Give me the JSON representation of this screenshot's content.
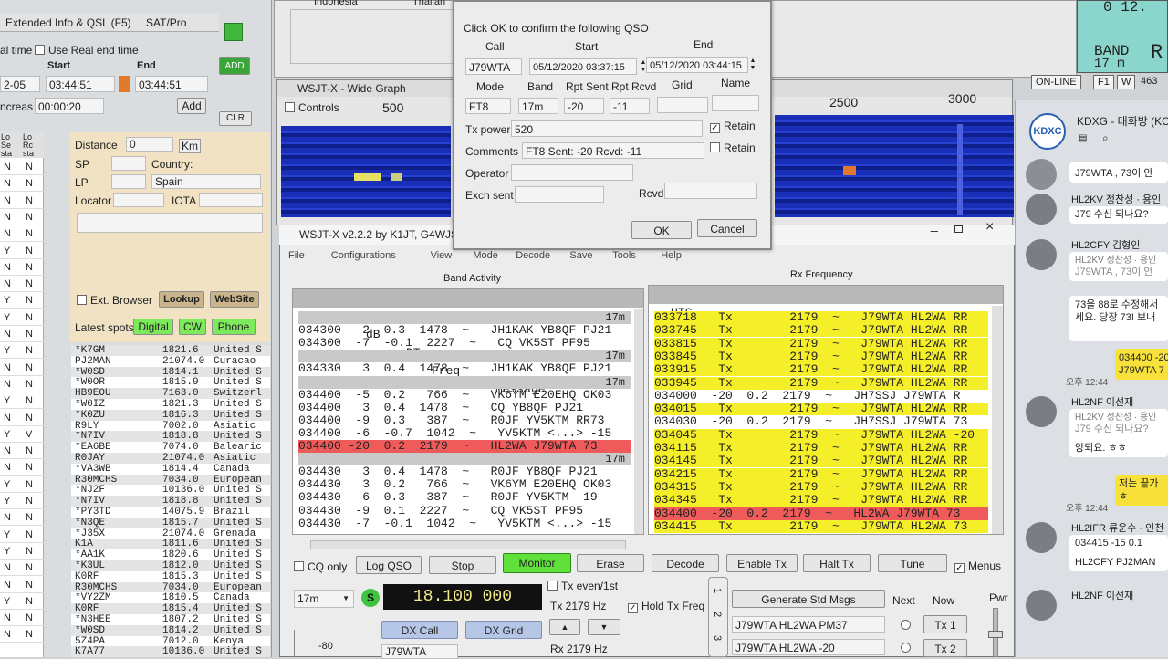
{
  "log_panel": {
    "tabs": [
      "Extended Info & QSL (F5)",
      "SAT/Pro"
    ],
    "real_time_label": "al time",
    "use_real_end_label": "Use Real end time",
    "start_label": "Start",
    "end_label": "End",
    "date_value": "2-05",
    "start_time": "03:44:51",
    "end_time": "03:44:51",
    "increase_label": "ncreas",
    "increase_value": "00:00:20",
    "add_green": "ADD",
    "add": "Add",
    "clr": "CLR",
    "col_headers": [
      "Lo Se sta",
      "Lo Rc sta"
    ],
    "yn_rows": [
      [
        "N",
        "N"
      ],
      [
        "N",
        "N"
      ],
      [
        "N",
        "N"
      ],
      [
        "N",
        "N"
      ],
      [
        "N",
        "N"
      ],
      [
        "Y",
        "N"
      ],
      [
        "N",
        "N"
      ],
      [
        "N",
        "N"
      ],
      [
        "Y",
        "N"
      ],
      [
        "Y",
        "N"
      ],
      [
        "N",
        "N"
      ],
      [
        "Y",
        "N"
      ],
      [
        "N",
        "N"
      ],
      [
        "N",
        "N"
      ],
      [
        "Y",
        "N"
      ],
      [
        "N",
        "N"
      ],
      [
        "Y",
        "V"
      ],
      [
        "N",
        "N"
      ],
      [
        "N",
        "N"
      ],
      [
        "Y",
        "N"
      ],
      [
        "Y",
        "N"
      ],
      [
        "N",
        "N"
      ],
      [
        "Y",
        "N"
      ],
      [
        "Y",
        "N"
      ],
      [
        "N",
        "N"
      ],
      [
        "N",
        "N"
      ],
      [
        "Y",
        "N"
      ],
      [
        "N",
        "N"
      ],
      [
        "N",
        "N"
      ]
    ]
  },
  "info_panel": {
    "distance_label": "Distance",
    "distance_value": "0",
    "km": "Km",
    "sp": "SP",
    "lp": "LP",
    "country_label": "Country:",
    "country_value": "Spain",
    "locator": "Locator",
    "iota": "IOTA",
    "ext_browser": "Ext. Browser",
    "lookup": "Lookup",
    "website": "WebSite",
    "latest_spots": "Latest spots",
    "spot_buttons": [
      "Digital",
      "CW",
      "Phone"
    ]
  },
  "spots": [
    [
      "*K7GM",
      "1821.6",
      "United S"
    ],
    [
      "PJ2MAN",
      "21074.0",
      "Curacao"
    ],
    [
      "*W0SD",
      "1814.1",
      "United S"
    ],
    [
      "*W0OR",
      "1815.9",
      "United S"
    ],
    [
      "HB9EOU",
      "7163.0",
      "Switzerl"
    ],
    [
      "*W0IZ",
      "1821.3",
      "United S"
    ],
    [
      "*K0ZU",
      "1816.3",
      "United S"
    ],
    [
      "R9LY",
      "7002.0",
      "Asiatic"
    ],
    [
      "*N7IV",
      "1818.8",
      "United S"
    ],
    [
      "*EA6BE",
      "7074.0",
      "Balearic"
    ],
    [
      "R0JAY",
      "21074.0",
      "Asiatic"
    ],
    [
      "*VA3WB",
      "1814.4",
      "Canada"
    ],
    [
      "R30MCHS",
      "7034.0",
      "European"
    ],
    [
      "*NJ2F",
      "10136.0",
      "United S"
    ],
    [
      "*N7IV",
      "1818.8",
      "United S"
    ],
    [
      "*PY3TD",
      "14075.9",
      "Brazil"
    ],
    [
      "*N3QE",
      "1815.7",
      "United S"
    ],
    [
      "*J35X",
      "21074.0",
      "Grenada"
    ],
    [
      "K1A",
      "1811.6",
      "United S"
    ],
    [
      "*AA1K",
      "1820.6",
      "United S"
    ],
    [
      "*K3UL",
      "1812.0",
      "United S"
    ],
    [
      "K0RF",
      "1815.3",
      "United S"
    ],
    [
      "R30MCHS",
      "7034.0",
      "European"
    ],
    [
      "*VY2ZM",
      "1810.5",
      "Canada"
    ],
    [
      "K0RF",
      "1815.4",
      "United S"
    ],
    [
      "*N3HEE",
      "1807.2",
      "United S"
    ],
    [
      "*W0SD",
      "1814.2",
      "United S"
    ],
    [
      "5Z4PA",
      "7012.0",
      "Kenya"
    ],
    [
      "K7A77",
      "10136.0",
      "United S"
    ]
  ],
  "top_window": {
    "country1": "Indonesia",
    "country2": "Thailan"
  },
  "top_right": {
    "band_label": "BAND",
    "band_value": "17 m",
    "clock": "0 12.",
    "status": [
      "ON-LINE",
      "F1",
      "W",
      "463"
    ]
  },
  "wide_graph": {
    "title": "WSJT-X - Wide Graph",
    "controls": "Controls",
    "ticks_left": [
      "500"
    ],
    "ticks_right": [
      "2500",
      "3000"
    ]
  },
  "confirm_dialog": {
    "prompt": "Click OK to confirm the following QSO",
    "call_label": "Call",
    "start_label": "Start",
    "end_label": "End",
    "call": "J79WTA",
    "start": "05/12/2020 03:37:15",
    "end": "05/12/2020 03:44:15",
    "mode_label": "Mode",
    "band_label": "Band",
    "rpt_sent_label": "Rpt Sent",
    "rpt_rcvd_label": "Rpt Rcvd",
    "grid_label": "Grid",
    "name_label": "Name",
    "mode": "FT8",
    "band": "17m",
    "rpt_sent": "-20",
    "rpt_rcvd": "-11",
    "tx_power_label": "Tx power",
    "tx_power": "520",
    "retain": "Retain",
    "comments_label": "Comments",
    "comments": "FT8  Sent: -20  Rcvd: -11",
    "operator_label": "Operator",
    "exch_sent_label": "Exch sent",
    "rcvd_label": "Rcvd",
    "ok": "OK",
    "cancel": "Cancel"
  },
  "wsjtx": {
    "title": "WSJT-X   v2.2.2   by K1JT, G4WJS",
    "menu": [
      "File",
      "Configurations",
      "View",
      "Mode",
      "Decode",
      "Save",
      "Tools",
      "Help"
    ],
    "band_activity": "Band Activity",
    "rx_frequency": "Rx Frequency",
    "headers": [
      "UTC",
      "dB",
      "DT",
      "Freq",
      "Message"
    ],
    "band_rows": [
      {
        "t": "",
        "sep": "17m"
      },
      {
        "t": "034300   2  0.3  1478  ~   JH1KAK YB8QF PJ21"
      },
      {
        "t": "034300  -7  -0.1  2227  ~   CQ VK5ST PF95"
      },
      {
        "t": "",
        "sep": "17m"
      },
      {
        "t": "034330   3  0.4  1478  ~   JH1KAK YB8QF PJ21"
      },
      {
        "t": "",
        "sep": "17m"
      },
      {
        "t": "034400  -5  0.2   766  ~   VK6YM E20EHQ OK03"
      },
      {
        "t": "034400   3  0.4  1478  ~   CQ YB8QF PJ21"
      },
      {
        "t": "034400  -9  0.3   387  ~   R0JF YV5KTM RR73"
      },
      {
        "t": "034400  -6  -0.7  1042  ~   YV5KTM <...> -15"
      },
      {
        "t": "034400 -20  0.2  2179  ~   HL2WA J79WTA 73",
        "hl": "red"
      },
      {
        "t": "",
        "sep": "17m"
      },
      {
        "t": "034430   3  0.4  1478  ~   R0JF YB8QF PJ21"
      },
      {
        "t": "034430   3  0.2   766  ~   VK6YM E20EHQ OK03"
      },
      {
        "t": "034430  -6  0.3   387  ~   R0JF YV5KTM -19"
      },
      {
        "t": "034430  -9  0.1  2227  ~   CQ VK5ST PF95"
      },
      {
        "t": "034430  -7  -0.1  1042  ~   YV5KTM <...> -15"
      }
    ],
    "rx_rows": [
      {
        "t": "033718   Tx        2179  ~   J79WTA HL2WA RR",
        "hl": "y"
      },
      {
        "t": "033745   Tx        2179  ~   J79WTA HL2WA RR",
        "hl": "y"
      },
      {
        "t": "033815   Tx        2179  ~   J79WTA HL2WA RR",
        "hl": "y"
      },
      {
        "t": "033845   Tx        2179  ~   J79WTA HL2WA RR",
        "hl": "y"
      },
      {
        "t": "033915   Tx        2179  ~   J79WTA HL2WA RR",
        "hl": "y"
      },
      {
        "t": "033945   Tx        2179  ~   J79WTA HL2WA RR",
        "hl": "y"
      },
      {
        "t": "034000  -20  0.2  2179  ~   JH7SSJ J79WTA R"
      },
      {
        "t": "034015   Tx        2179  ~   J79WTA HL2WA RR",
        "hl": "y"
      },
      {
        "t": "034030  -20  0.2  2179  ~   JH7SSJ J79WTA 73"
      },
      {
        "t": "034045   Tx        2179  ~   J79WTA HL2WA -20",
        "hl": "y"
      },
      {
        "t": "034115   Tx        2179  ~   J79WTA HL2WA RR",
        "hl": "y"
      },
      {
        "t": "034145   Tx        2179  ~   J79WTA HL2WA RR",
        "hl": "y"
      },
      {
        "t": "034215   Tx        2179  ~   J79WTA HL2WA RR",
        "hl": "y"
      },
      {
        "t": "034315   Tx        2179  ~   J79WTA HL2WA RR",
        "hl": "y"
      },
      {
        "t": "034345   Tx        2179  ~   J79WTA HL2WA RR",
        "hl": "y"
      },
      {
        "t": "034400  -20  0.2  2179  ~   HL2WA J79WTA 73",
        "hl": "red"
      },
      {
        "t": "034415   Tx        2179  ~   J79WTA HL2WA 73",
        "hl": "y"
      }
    ],
    "cq_only": "CQ only",
    "log_qso": "Log QSO",
    "stop": "Stop",
    "monitor": "Monitor",
    "erase": "Erase",
    "decode": "Decode",
    "enable_tx": "Enable Tx",
    "halt_tx": "Halt Tx",
    "tune": "Tune",
    "menus": "Menus",
    "band_select": "17m",
    "s_badge": "S",
    "frequency": "18.100 000",
    "tx_even": "Tx even/1st",
    "tx_hz": "Tx 2179 Hz",
    "hold_tx": "Hold Tx Freq",
    "rx_hz": "Rx 2179 Hz",
    "dx_call": "DX Call",
    "dx_grid": "DX Grid",
    "dx_call_value": "J79WTA",
    "level": "-80",
    "gen_std": "Generate Std Msgs",
    "next": "Next",
    "now": "Now",
    "pwr": "Pwr",
    "tx_msgs": [
      "J79WTA HL2WA PM37",
      "J79WTA HL2WA -20"
    ],
    "tx_buttons": [
      "Tx 1",
      "Tx 2"
    ],
    "tab_digits": [
      "1",
      "2",
      "3"
    ]
  },
  "chat": {
    "header": "KDXG - 대화방 (KC",
    "logo": "KDXC",
    "messages": [
      {
        "type": "in",
        "text": "J79WTA , 73이 안"
      },
      {
        "type": "name",
        "name": "HL2KV 정찬성 · 용인",
        "text": "J79 수신 되나요?"
      },
      {
        "type": "name",
        "name": "HL2CFY 김형인",
        "quote": "HL2KV 정찬성 · 용인",
        "text": "J79WTA , 73이 안"
      },
      {
        "type": "plain",
        "text": "73을 88로 수정해서 세요. 당장 73! 보내"
      },
      {
        "type": "out",
        "text": "034400 -20",
        "text2": "J79WTA 7",
        "time": "오후 12:44"
      },
      {
        "type": "name",
        "name": "HL2NF 이선재",
        "quote": "HL2KV 정찬성 · 용인",
        "text": "J79 수신 되나요?",
        "text2": "앙되요. ㅎㅎ"
      },
      {
        "type": "out",
        "text": "저는 끝가",
        "text2": "ㅎ",
        "time": "오후 12:44"
      },
      {
        "type": "name",
        "name": "HL2IFR 류운수 · 인천",
        "text": "034415 -15  0.1",
        "text2": "HL2CFY PJ2MAN"
      },
      {
        "type": "name",
        "name": "HL2NF 이선재"
      }
    ]
  },
  "colors": {
    "yellow": "#f5ef2a",
    "red": "#ef5a5a",
    "green_btn": "#5fe03a",
    "sep": "#c9c9c9"
  }
}
